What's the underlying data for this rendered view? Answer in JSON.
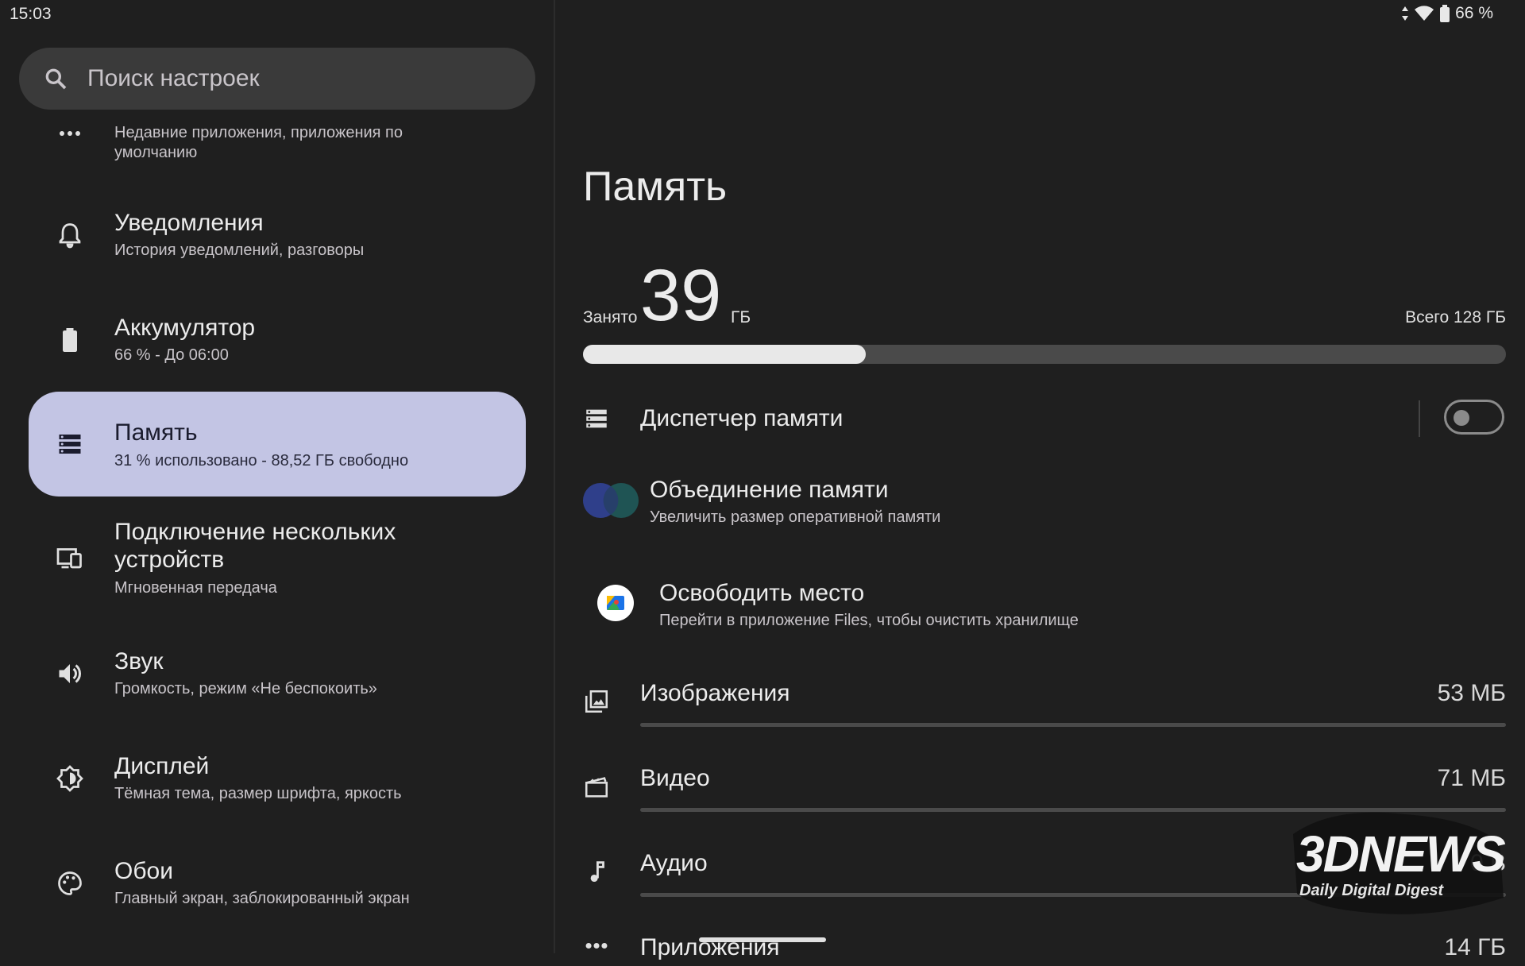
{
  "status_bar": {
    "time": "15:03",
    "battery": "66 %"
  },
  "search": {
    "placeholder": "Поиск настроек"
  },
  "sidebar": {
    "items": [
      {
        "title": "",
        "subtitle": "Недавние приложения, приложения по умолчанию",
        "icon": "more-horiz-icon"
      },
      {
        "title": "Уведомления",
        "subtitle": "История уведомлений, разговоры",
        "icon": "bell-icon"
      },
      {
        "title": "Аккумулятор",
        "subtitle": "66 % - До 06:00",
        "icon": "battery-icon"
      },
      {
        "title": "Память",
        "subtitle": "31 % использовано - 88,52 ГБ свободно",
        "icon": "storage-icon",
        "selected": true
      },
      {
        "title": "Подключение нескольких устройств",
        "subtitle": "Мгновенная передача",
        "icon": "devices-icon"
      },
      {
        "title": "Звук",
        "subtitle": "Громкость, режим «Не беспокоить»",
        "icon": "volume-icon"
      },
      {
        "title": "Дисплей",
        "subtitle": "Тёмная тема, размер шрифта, яркость",
        "icon": "brightness-icon"
      },
      {
        "title": "Обои",
        "subtitle": "Главный экран, заблокированный экран",
        "icon": "palette-icon"
      }
    ]
  },
  "storage": {
    "title": "Память",
    "used_label": "Занято",
    "used_value": "39",
    "used_unit": "ГБ",
    "total_label": "Всего 128 ГБ",
    "used_fraction": 0.306
  },
  "rows": {
    "manager": {
      "title": "Диспетчер памяти",
      "enabled": false
    },
    "merge": {
      "title": "Объединение памяти",
      "subtitle": "Увеличить размер оперативной памяти"
    },
    "free": {
      "title": "Освободить место",
      "subtitle": "Перейти в приложение Files, чтобы очистить хранилище"
    }
  },
  "categories": [
    {
      "name": "Изображения",
      "size": "53 МБ",
      "icon": "image-icon"
    },
    {
      "name": "Видео",
      "size": "71 МБ",
      "icon": "video-icon"
    },
    {
      "name": "Аудио",
      "size": "0 В",
      "icon": "music-icon"
    },
    {
      "name": "Приложения",
      "size": "14 ГБ",
      "icon": "apps-icon"
    }
  ],
  "watermark": {
    "brand": "3DNEWS",
    "tagline": "Daily Digital Digest"
  },
  "colors": {
    "background": "#1f1f1f",
    "selected_item": "#c3c5e4",
    "bar_fill": "#e8e8e8"
  }
}
